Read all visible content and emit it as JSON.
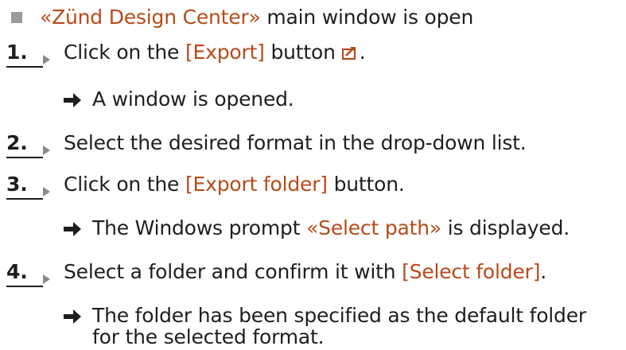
{
  "prerequisite": {
    "text_before": "«Zünd Design Center»",
    "text_after": " main window is open"
  },
  "steps": [
    {
      "number": "1.",
      "text_before": "Click on the ",
      "button": "[Export]",
      "text_after": " button",
      "icon": "export-icon",
      "trailing": "."
    },
    {
      "number": "2.",
      "text": "Select the desired format in the drop-down list."
    },
    {
      "number": "3.",
      "text_before": "Click on the ",
      "button": "[Export folder]",
      "text_after": " button."
    },
    {
      "number": "4.",
      "text_before": "Select a folder and confirm it with ",
      "button": "[Select folder]",
      "text_after": "."
    }
  ],
  "results": [
    {
      "text": "A window is opened."
    },
    {
      "text_before": "The Windows prompt ",
      "highlight": "«Select path»",
      "text_after": " is displayed."
    },
    {
      "line1": "The folder has been specified as the default folder",
      "line2": "for the selected format."
    }
  ],
  "colors": {
    "accent": "#b84a1a",
    "text": "#1e1e1e",
    "bullet": "#9a9a9a"
  }
}
